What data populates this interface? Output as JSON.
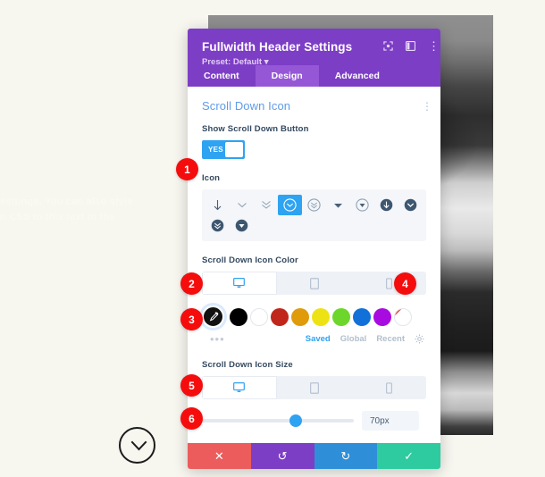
{
  "background": {
    "paragraph_text": "settings. You can also style\nn CSS to this text in the",
    "scroll_down_icon": "chevron-down-circle"
  },
  "modal": {
    "title": "Fullwidth Header Settings",
    "preset": "Preset: Default",
    "header_icons": [
      "expand-icon",
      "layout-icon",
      "kebab-menu-icon"
    ],
    "tabs": [
      {
        "label": "Content",
        "active": false
      },
      {
        "label": "Design",
        "active": true
      },
      {
        "label": "Advanced",
        "active": false
      }
    ]
  },
  "section": {
    "title": "Scroll Down Icon",
    "kebab": "⋮"
  },
  "show_scroll_down": {
    "label": "Show Scroll Down Button",
    "value": "YES"
  },
  "icon_picker": {
    "label": "Icon",
    "selected_index": 3,
    "icons": [
      "arrow-down",
      "chevron-down-thin",
      "double-chevron-down",
      "chevron-down-circle-outline",
      "double-chevron-down-circle-outline",
      "caret-down-solid",
      "caret-down-circle-outline",
      "arrow-down-circle-solid",
      "chevron-down-circle-solid",
      "double-chevron-down-circle-solid",
      "caret-down-circle-solid"
    ]
  },
  "icon_color": {
    "label": "Scroll Down Icon Color",
    "devices": [
      {
        "name": "desktop-icon",
        "active": true
      },
      {
        "name": "tablet-icon",
        "active": false
      },
      {
        "name": "phone-icon",
        "active": false
      }
    ],
    "eyedropper": "eyedropper-icon",
    "swatches": [
      {
        "name": "black",
        "hex": "#000000"
      },
      {
        "name": "white",
        "hex": "#FFFFFF"
      },
      {
        "name": "red",
        "hex": "#C0261A"
      },
      {
        "name": "orange",
        "hex": "#E09B0A"
      },
      {
        "name": "yellow",
        "hex": "#EDE314"
      },
      {
        "name": "green",
        "hex": "#6DD62B"
      },
      {
        "name": "blue",
        "hex": "#1271D8"
      },
      {
        "name": "purple",
        "hex": "#A80BE0"
      },
      {
        "name": "transparent",
        "hex": "none"
      }
    ],
    "more_dots": "•••",
    "tabs": [
      {
        "label": "Saved",
        "active": true
      },
      {
        "label": "Global",
        "active": false
      },
      {
        "label": "Recent",
        "active": false
      }
    ],
    "settings_icon": "gear-icon"
  },
  "icon_size": {
    "label": "Scroll Down Icon Size",
    "devices": [
      {
        "name": "desktop-icon",
        "active": true
      },
      {
        "name": "tablet-icon",
        "active": false
      },
      {
        "name": "phone-icon",
        "active": false
      }
    ],
    "value": "70px",
    "slider_percent": 58
  },
  "footer": {
    "cancel": "✕",
    "undo": "↺",
    "redo": "↻",
    "save": "✓"
  },
  "badges": [
    {
      "number": "1"
    },
    {
      "number": "2"
    },
    {
      "number": "3"
    },
    {
      "number": "4"
    },
    {
      "number": "5"
    },
    {
      "number": "6"
    }
  ],
  "colors": {
    "brand_purple": "#7D3EC6",
    "accent_blue": "#2EA3F2",
    "badge_red": "#F50D0D",
    "save_green": "#2ECBA0",
    "cancel_red": "#EC5C5C",
    "page_bg": "#F7F6EF"
  }
}
